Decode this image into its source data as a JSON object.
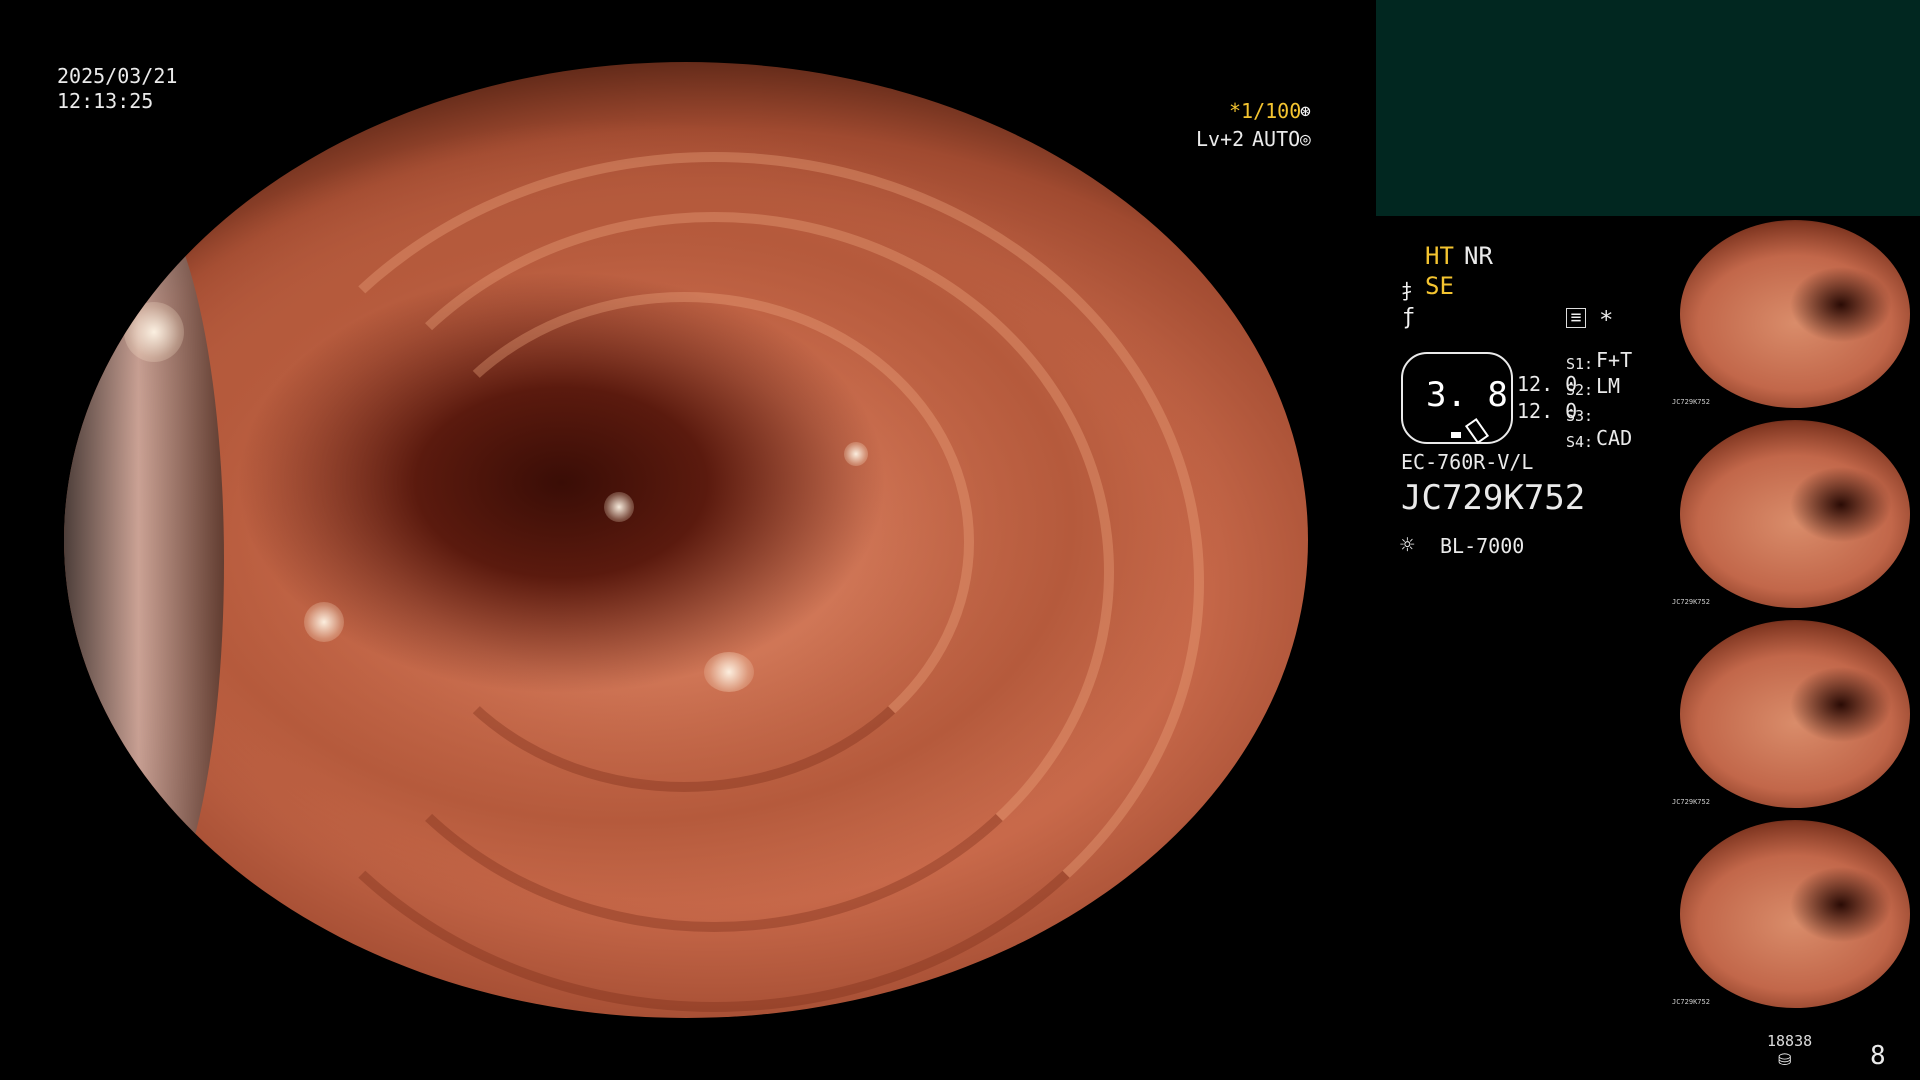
{
  "overlay": {
    "date": "2025/03/21",
    "time": "12:13:25",
    "shutter": "*1/100",
    "shutter_icon": "shutter-icon",
    "level": "Lv+2",
    "auto": "AUTO",
    "auto_icon": "iris-icon"
  },
  "panel": {
    "ht": "HT",
    "nr": "NR",
    "se": "SE",
    "enhance_icon": "enhance-icon",
    "f_icon": "f-mode-icon",
    "memo_icon": "memo-icon",
    "star": "*",
    "zoom_value": "3. 8",
    "val1": "12. 0",
    "val2": "12. 0",
    "s1_label": "S1:",
    "s1_value": "F+T",
    "s2_label": "S2:",
    "s2_value": "LM",
    "s3_label": "S3:",
    "s3_value": "",
    "s4_label": "S4:",
    "s4_value": "CAD",
    "model": "EC-760R-V/L",
    "serial": "JC729K752",
    "light_icon": "light-source-icon",
    "light_source": "BL-7000",
    "thumb_serial": "JC729K752",
    "storage_count": "18838",
    "storage_icon": "storage-icon",
    "page_number": "8"
  },
  "colors": {
    "top_panel": "#012720",
    "accent_yellow": "#f4c430"
  }
}
